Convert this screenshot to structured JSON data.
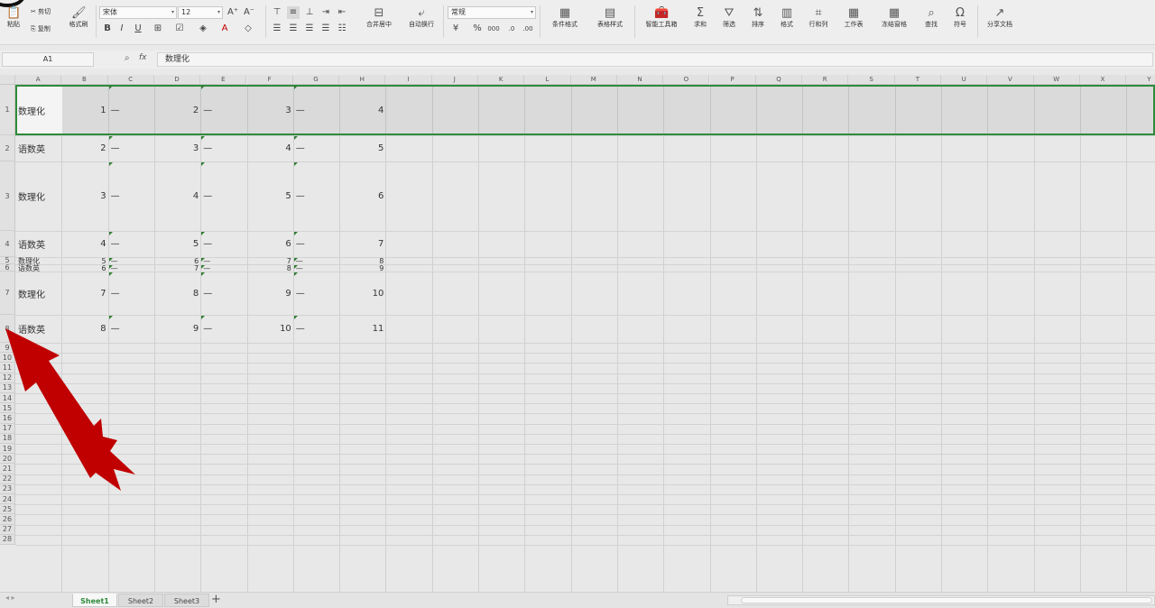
{
  "ribbon": {
    "paste": "粘贴",
    "cut": "剪切",
    "copy": "复制",
    "format_painter": "格式刷",
    "font_name": "宋体",
    "font_size": "12",
    "bold": "B",
    "italic": "I",
    "underline": "U",
    "merge_center": "合并居中",
    "wrap_text": "自动换行",
    "number_format": "常规",
    "percent": "%",
    "conditional_format": "条件格式",
    "table_style": "表格样式",
    "smart_toolbox": "智能工具箱",
    "sum": "求和",
    "filter": "筛选",
    "sort": "排序",
    "format": "格式",
    "row_col": "行和列",
    "worksheet": "工作表",
    "freeze": "冻结窗格",
    "find": "查找",
    "symbol": "符号",
    "share": "分享文档"
  },
  "formula_bar": {
    "name_box": "A1",
    "fx": "fx",
    "content": "数理化"
  },
  "columns": [
    "A",
    "B",
    "C",
    "D",
    "E",
    "F",
    "G",
    "H",
    "I",
    "J",
    "K",
    "L",
    "M",
    "N",
    "O",
    "P",
    "Q",
    "R",
    "S",
    "T",
    "U",
    "V",
    "W",
    "X",
    "Y"
  ],
  "rows": [
    {
      "num": "1",
      "a": "数理化",
      "b": "1",
      "d": "2",
      "f": "3",
      "h": "4"
    },
    {
      "num": "2",
      "a": "语数英",
      "b": "2",
      "d": "3",
      "f": "4",
      "h": "5"
    },
    {
      "num": "3",
      "a": "数理化",
      "b": "3",
      "d": "4",
      "f": "5",
      "h": "6"
    },
    {
      "num": "4",
      "a": "语数英",
      "b": "4",
      "d": "5",
      "f": "6",
      "h": "7"
    },
    {
      "num": "5",
      "a": "数理化",
      "b": "5",
      "d": "6",
      "f": "7",
      "h": "8"
    },
    {
      "num": "6",
      "a": "语数英",
      "b": "6",
      "d": "7",
      "f": "8",
      "h": "9"
    },
    {
      "num": "7",
      "a": "数理化",
      "b": "7",
      "d": "8",
      "f": "9",
      "h": "10"
    },
    {
      "num": "8",
      "a": "语数英",
      "b": "8",
      "d": "9",
      "f": "10",
      "h": "11"
    }
  ],
  "empty_rows": [
    "9",
    "10",
    "11",
    "12",
    "13",
    "14",
    "15",
    "16",
    "17",
    "18",
    "19",
    "20",
    "21",
    "22",
    "23",
    "24",
    "25",
    "26",
    "27",
    "28"
  ],
  "dash": "—",
  "sheets": [
    "Sheet1",
    "Sheet2",
    "Sheet3"
  ],
  "add_sheet": "+",
  "colors": {
    "accent": "#2e8b3a",
    "arrow": "#c00000"
  }
}
